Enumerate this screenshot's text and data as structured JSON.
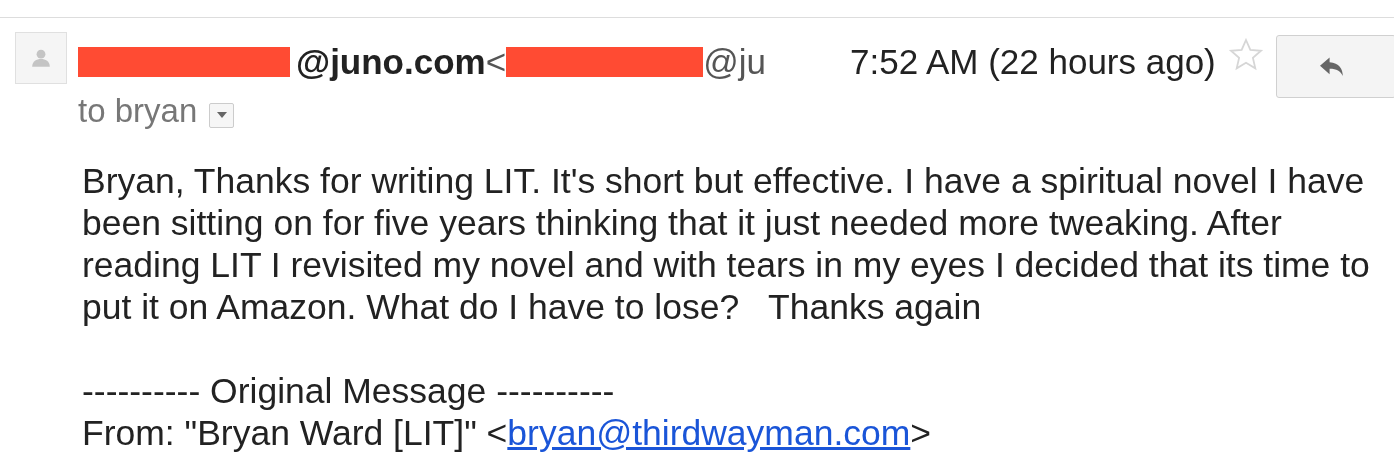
{
  "message": {
    "sender_name": "@juno.com",
    "sender_email_open": "<",
    "sender_email": "@ju",
    "time": "7:52 AM (22 hours ago)",
    "starred": false,
    "recipient": "to bryan",
    "body": "Bryan, Thanks for writing LIT. It's short but effective. I have a spiritual novel I have been sitting on for five years thinking that it just needed more tweaking. After reading LIT I revisited my novel and with tears in my eyes I decided that its time to put it on Amazon. What do I have to lose?   Thanks again",
    "quoted_header": "---------- Original Message ----------",
    "from_label": "From: \"Bryan Ward [LIT]\" <",
    "from_link": "bryan@thirdwayman.com",
    "from_close": ">"
  }
}
